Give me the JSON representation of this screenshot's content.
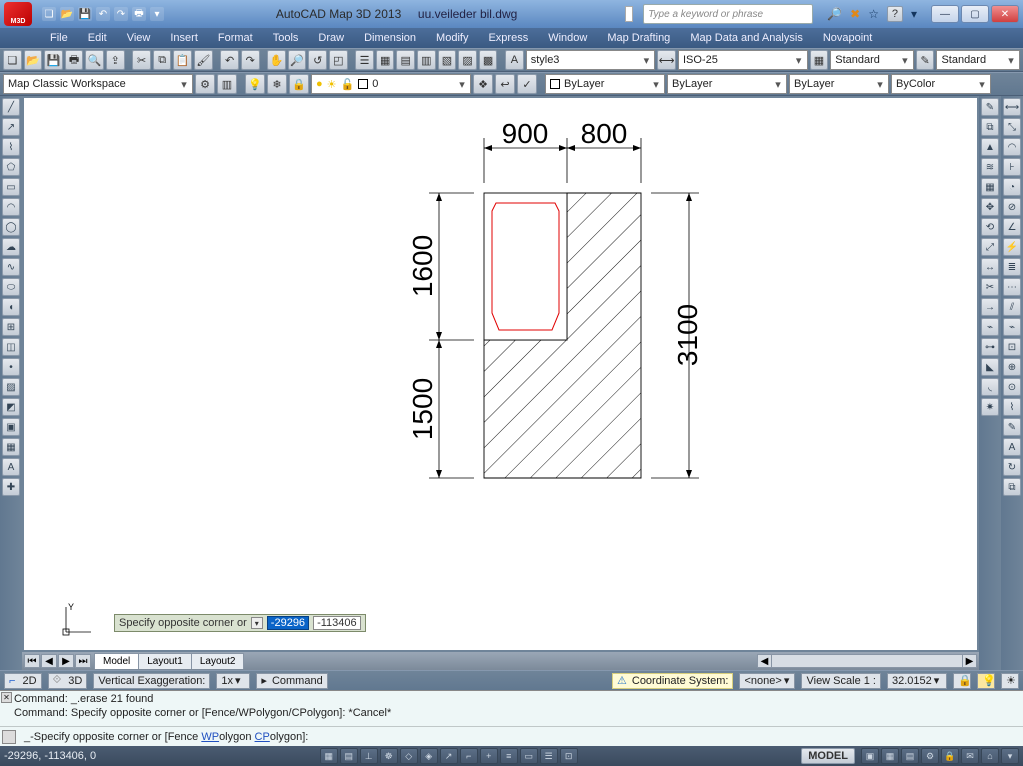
{
  "app": {
    "name": "AutoCAD Map 3D 2013",
    "document": "uu.veileder bil.dwg",
    "icon_label": "M3D"
  },
  "search": {
    "placeholder": "Type a keyword or phrase"
  },
  "menus": [
    "File",
    "Edit",
    "View",
    "Insert",
    "Format",
    "Tools",
    "Draw",
    "Dimension",
    "Modify",
    "Express",
    "Window",
    "Map Drafting",
    "Map Data and Analysis",
    "Novapoint"
  ],
  "toolbars": {
    "style_combo": "style3",
    "dim_combo": "ISO-25",
    "text_combo": "Standard",
    "table_combo": "Standard",
    "workspace": "Map Classic Workspace",
    "layer_value": "0",
    "prop_color": "ByLayer",
    "prop_line": "ByLayer",
    "prop_weight": "ByLayer",
    "prop_plot": "ByColor"
  },
  "drawing": {
    "dims": {
      "top_left": "900",
      "top_right": "800",
      "left_upper": "1600",
      "left_lower": "1500",
      "right": "3100"
    }
  },
  "coord_tip": {
    "prompt": "Specify opposite corner or",
    "x": "-29296",
    "y": "-113406"
  },
  "tabs": {
    "model": "Model",
    "layout1": "Layout1",
    "layout2": "Layout2"
  },
  "viewbar": {
    "mode2d": "2D",
    "mode3d": "3D",
    "ve_label": "Vertical Exaggeration:",
    "ve_value": "1x",
    "command": "Command",
    "cs_label": "Coordinate System:",
    "cs_value": "<none>",
    "scale_label": "View Scale  1 :",
    "scale_value": "32.0152"
  },
  "cmdlog": {
    "line1": "Command: _.erase 21 found",
    "line2": "Command: Specify opposite corner or [Fence/WPolygon/CPolygon]: *Cancel*"
  },
  "cmdline": {
    "prefix": "_-Specify opposite corner or [",
    "opt1a": "Fence",
    "sep": " ",
    "opt2a": "WP",
    "opt2b": "olygon",
    "opt3a": "CP",
    "opt3b": "olygon",
    "suffix": "]:"
  },
  "statusbar": {
    "coords": "-29296, -113406, 0",
    "model": "MODEL"
  }
}
